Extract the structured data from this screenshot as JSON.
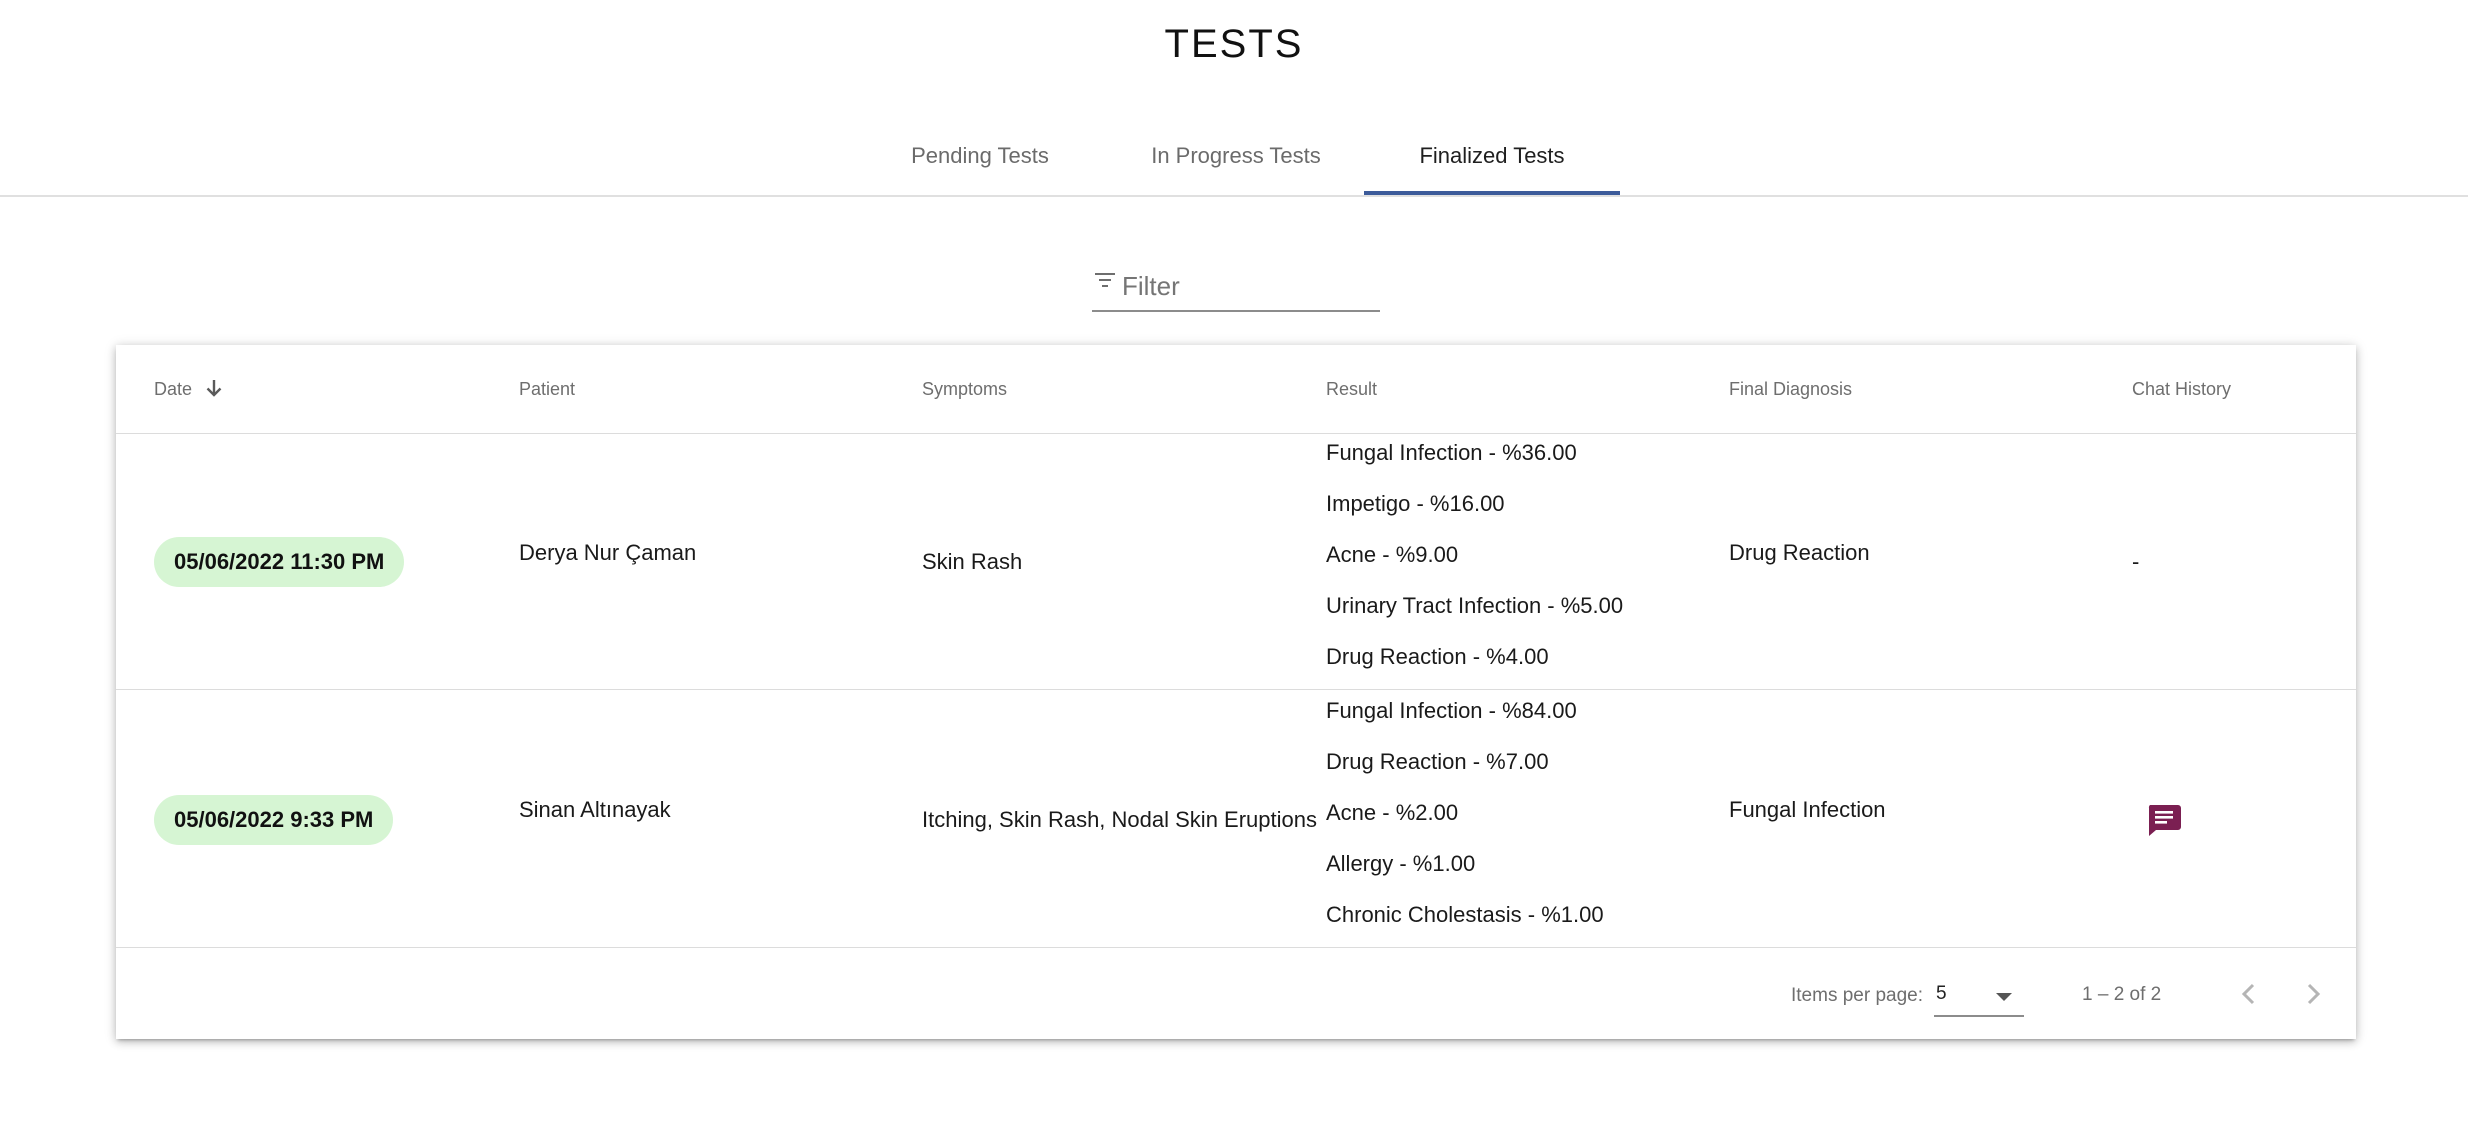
{
  "page": {
    "title": "TESTS"
  },
  "tabs": [
    {
      "label": "Pending Tests",
      "active": false
    },
    {
      "label": "In Progress Tests",
      "active": false
    },
    {
      "label": "Finalized Tests",
      "active": true
    }
  ],
  "filter": {
    "placeholder": "Filter",
    "value": "",
    "icon": "filter-icon"
  },
  "table": {
    "columns": [
      "Date",
      "Patient",
      "Symptoms",
      "Result",
      "Final Diagnosis",
      "Chat History"
    ],
    "sort": {
      "column": "Date",
      "direction": "descending",
      "icon": "arrow-down-icon"
    },
    "rows": [
      {
        "date": "05/06/2022 11:30 PM",
        "patient": "Derya Nur Çaman",
        "symptoms": "Skin Rash",
        "results": [
          "Fungal Infection - %36.00",
          "Impetigo - %16.00",
          "Acne - %9.00",
          "Urinary Tract Infection - %5.00",
          "Drug Reaction - %4.00"
        ],
        "final_diagnosis": "Drug Reaction",
        "chat_history": "-"
      },
      {
        "date": "05/06/2022 9:33 PM",
        "patient": "Sinan Altınayak",
        "symptoms": "Itching, Skin Rash, Nodal Skin Eruptions",
        "results": [
          "Fungal Infection - %84.00",
          "Drug Reaction - %7.00",
          "Acne - %2.00",
          "Allergy - %1.00",
          "Chronic Cholestasis - %1.00"
        ],
        "final_diagnosis": "Fungal Infection",
        "chat_history": ""
      }
    ]
  },
  "paginator": {
    "items_per_page_label": "Items per page:",
    "page_size": "5",
    "range_label": "1 – 2 of 2"
  },
  "colors": {
    "tab_indicator": "#3c5b9a",
    "date_chip": "#d6f5d3",
    "chat_icon": "#7b1f52"
  }
}
